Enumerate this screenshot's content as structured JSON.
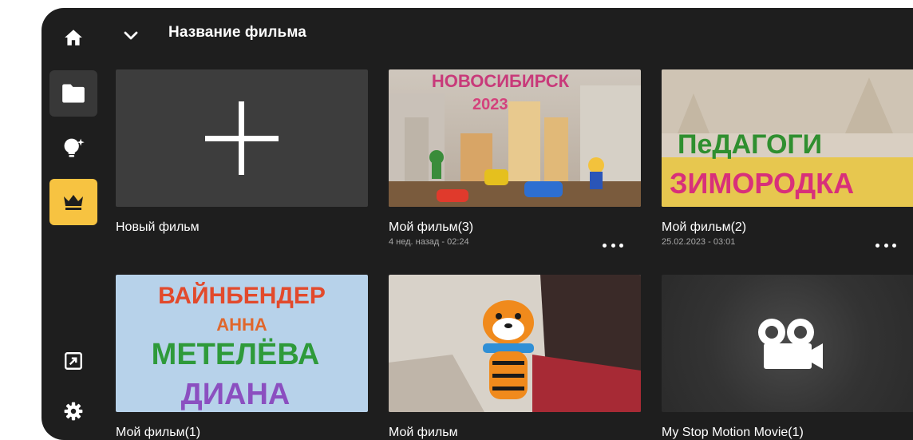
{
  "header": {
    "title": "Название фильма"
  },
  "cards": [
    {
      "title": "Новый фильм",
      "subtitle": "",
      "thumb": "new-film-plus"
    },
    {
      "title": "Мой фильм(3)",
      "subtitle": "4 нед. назад - 02:24",
      "thumb": "plasticine-city-scene"
    },
    {
      "title": "Мой фильм(2)",
      "subtitle": "25.02.2023 - 03:01",
      "thumb": "plasticine-lettering-scene"
    },
    {
      "title": "Мой фильм(1)",
      "subtitle": "",
      "thumb": "plasticine-names-scene"
    },
    {
      "title": "Мой фильм",
      "subtitle": "",
      "thumb": "plasticine-tiger-scene"
    },
    {
      "title": "My Stop Motion Movie(1)",
      "subtitle": "",
      "thumb": "movie-camera-placeholder"
    }
  ],
  "thumb_text": {
    "card2_top": "НОВОСИБИРСК",
    "card2_year": "2023",
    "card3_line1": "ПеДАГОГИ",
    "card3_line2": "ЗИМОРОДКА",
    "card4_line1": "ВАЙНБЕНДЕР",
    "card4_line2": "АННА",
    "card4_line3": "МЕТЕЛЁВА",
    "card4_line4": "ДИАНА"
  },
  "icons": [
    "home-icon",
    "folder-icon",
    "lightbulb-sparkle-icon",
    "crown-icon",
    "cast-icon",
    "gear-icon",
    "chevron-down-icon",
    "plus-icon",
    "more-icon",
    "movie-camera-icon"
  ],
  "colors": {
    "background": "#1e1e1e",
    "accent": "#f7c341",
    "selected": "#383838"
  }
}
